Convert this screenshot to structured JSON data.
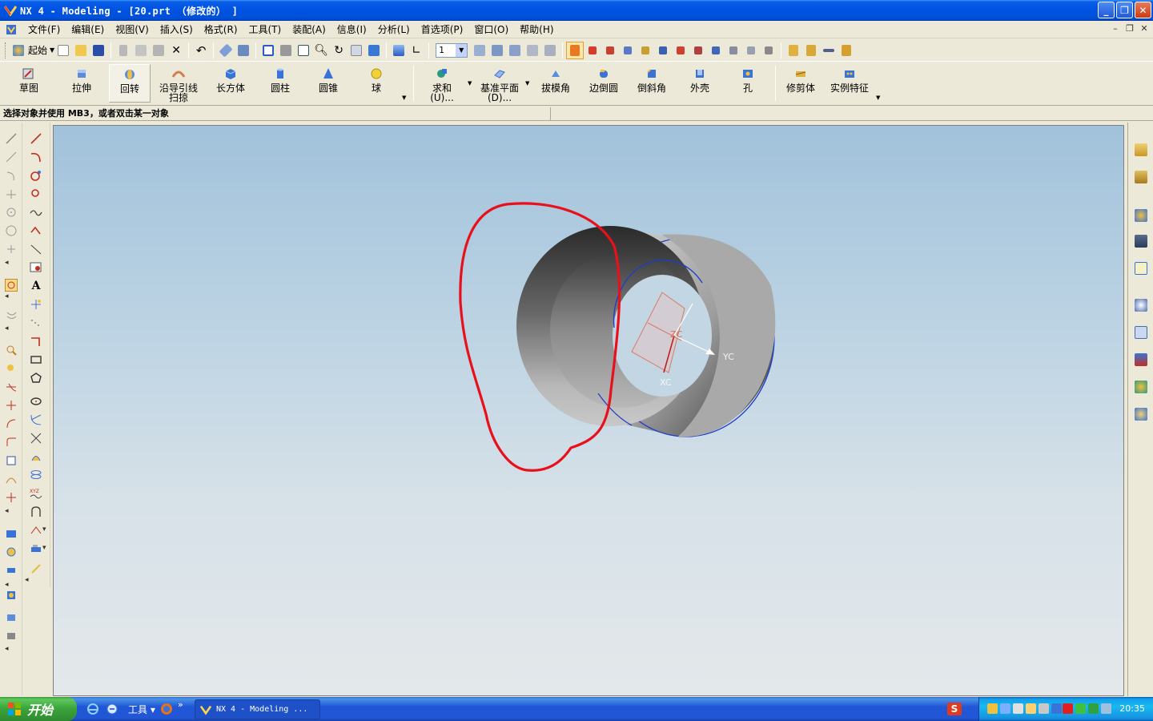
{
  "window": {
    "title": "NX 4 - Modeling - [20.prt （修改的） ]",
    "minimize": "_",
    "maximize": "❐",
    "close": "✕"
  },
  "menubar": {
    "items": [
      "文件(F)",
      "编辑(E)",
      "视图(V)",
      "插入(S)",
      "格式(R)",
      "工具(T)",
      "装配(A)",
      "信息(I)",
      "分析(L)",
      "首选项(P)",
      "窗口(O)",
      "帮助(H)"
    ],
    "mdi": [
      "–",
      "❐",
      "✕"
    ]
  },
  "toolbar_standard": {
    "start_label": "起始",
    "layer_value": "1",
    "dropdown_glyph": "▼"
  },
  "toolbar_features": {
    "sketch": "草图",
    "extrude": "拉伸",
    "revolve": "回转",
    "sweep": "沿导引线\n扫掠",
    "block": "长方体",
    "cylinder": "圆柱",
    "cone": "圆锥",
    "sphere": "球",
    "unite": "求和\n(U)...",
    "datum_plane": "基准平面\n(D)...",
    "draft": "拔模角",
    "edge_blend": "边倒圆",
    "chamfer": "倒斜角",
    "shell": "外壳",
    "hole": "孔",
    "trim_body": "修剪体",
    "instance_feature": "实例特征"
  },
  "cue_line": {
    "prompt": "选择对象并使用 MB3，或者双击某一对象",
    "status": ""
  },
  "viewport": {
    "csys_labels": {
      "zc": "ZC",
      "yc": "YC",
      "xc": "XC"
    }
  },
  "taskbar": {
    "start": "开始",
    "tools_label": "工具",
    "tools_more": "»",
    "task_nx": "NX 4 - Modeling ...",
    "ime": "S",
    "clock": "20:35"
  },
  "colors": {
    "annotation": "#e8101a",
    "edge_highlight": "#1a3ccc",
    "accent_title": "#0054e3"
  }
}
